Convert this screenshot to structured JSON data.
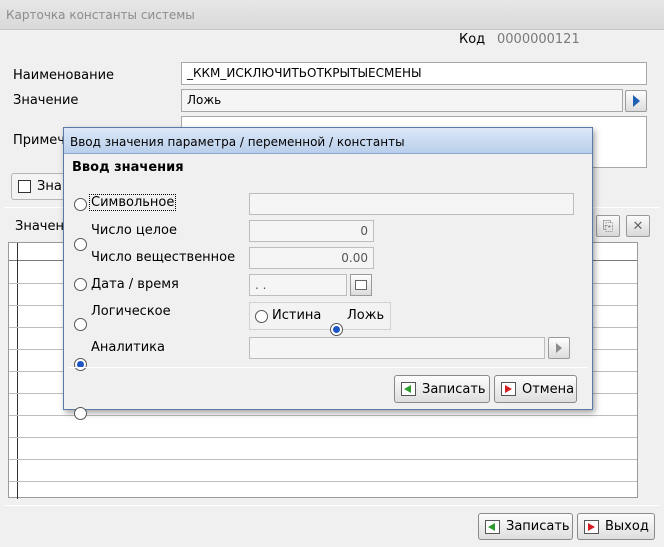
{
  "window": {
    "title": "Карточка константы системы"
  },
  "code": {
    "label": "Код",
    "value": "0000000121"
  },
  "form": {
    "name_label": "Наименование",
    "name_value": "_ККМ_ИСКЛЮЧИТЬОТКРЫТЫЕСМЕНЫ",
    "value_label": "Значение",
    "value_value": "Ложь",
    "note_label": "Примеч",
    "checkbox_label": "Зна",
    "values_section_label": "Значен"
  },
  "footer": {
    "save_label": "Записать",
    "exit_label": "Выход"
  },
  "dialog": {
    "title": "Ввод значения параметра / переменной / константы",
    "heading": "Ввод значения",
    "options": {
      "symbolic": "Символьное",
      "integer": "Число целое",
      "real": "Число вещественное",
      "datetime": "Дата / время",
      "logical": "Логическое",
      "analytics": "Аналитика"
    },
    "integer_value": "0",
    "real_value": "0.00",
    "datetime_value": " .  .",
    "logical_true": "Истина",
    "logical_false": "Ложь",
    "selected_option": "logical",
    "selected_logical": "false",
    "save_label": "Записать",
    "cancel_label": "Отмена"
  }
}
